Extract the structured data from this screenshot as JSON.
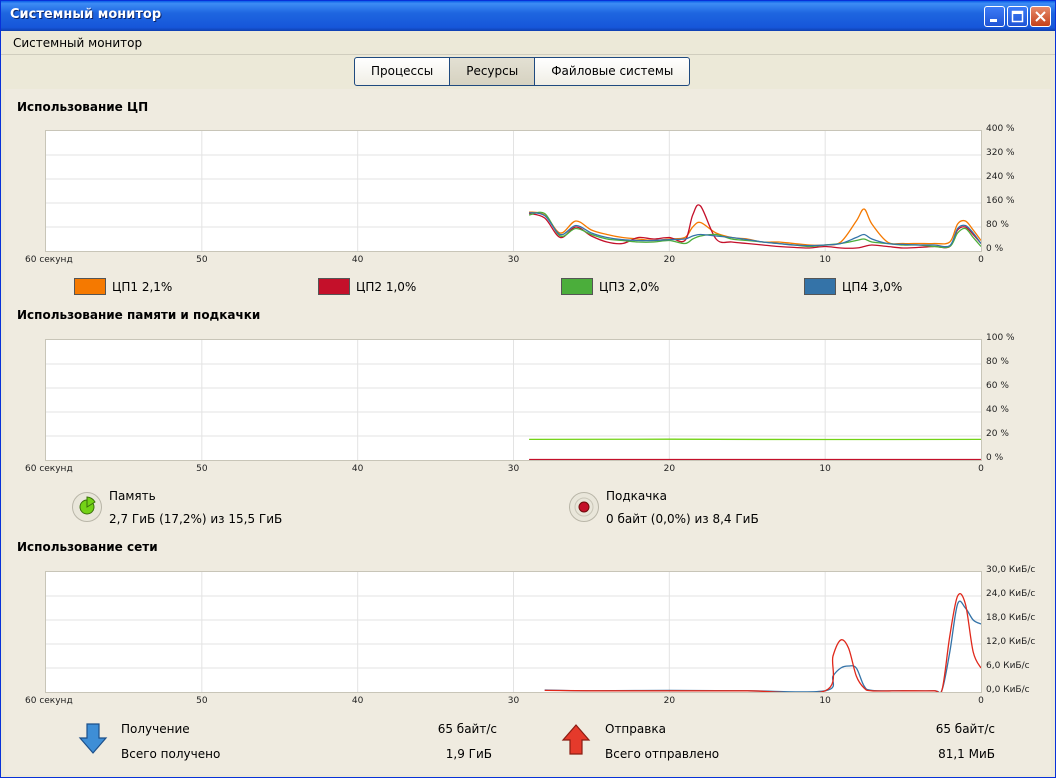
{
  "window": {
    "title": "Системный монитор"
  },
  "menu": {
    "app_menu": "Системный монитор"
  },
  "tabs": [
    {
      "label": "Процессы",
      "active": false
    },
    {
      "label": "Ресурсы",
      "active": true
    },
    {
      "label": "Файловые системы",
      "active": false
    }
  ],
  "time_axis": [
    "60 секунд",
    "50",
    "40",
    "30",
    "20",
    "10",
    "0"
  ],
  "cpu": {
    "title": "Использование ЦП",
    "y_ticks": [
      "400 %",
      "320 %",
      "240 %",
      "160 %",
      "80 %",
      "0 %"
    ],
    "legend": [
      {
        "name": "ЦП1",
        "value": "2,1%",
        "color": "#F57900"
      },
      {
        "name": "ЦП2",
        "value": "1,0%",
        "color": "#C4102A"
      },
      {
        "name": "ЦП3",
        "value": "2,0%",
        "color": "#4BAE3B"
      },
      {
        "name": "ЦП4",
        "value": "3,0%",
        "color": "#3473A8"
      }
    ]
  },
  "memory": {
    "title": "Использование памяти и подкачки",
    "y_ticks": [
      "100 %",
      "80 %",
      "60 %",
      "40 %",
      "20 %",
      "0 %"
    ],
    "mem_label": "Память",
    "mem_value": "2,7 ГиБ (17,2%) из 15,5 ГиБ",
    "mem_color": "#73D216",
    "swap_label": "Подкачка",
    "swap_value": "0 байт (0,0%) из 8,4 ГиБ",
    "swap_color": "#C4102A"
  },
  "network": {
    "title": "Использование сети",
    "y_ticks": [
      "30,0 КиБ/с",
      "24,0 КиБ/с",
      "18,0 КиБ/с",
      "12,0 КиБ/с",
      "6,0 КиБ/с",
      "0,0 КиБ/с"
    ],
    "recv_label": "Получение",
    "recv_rate": "65 байт/с",
    "recv_total_label": "Всего получено",
    "recv_total": "1,9 ГиБ",
    "recv_color": "#3473A8",
    "send_label": "Отправка",
    "send_rate": "65 байт/с",
    "send_total_label": "Всего отправлено",
    "send_total": "81,1 МиБ",
    "send_color": "#E0281B"
  },
  "chart_data": [
    {
      "type": "line",
      "title": "Использование ЦП",
      "x": [
        29,
        28,
        27,
        26,
        25,
        24,
        23,
        22,
        21,
        20,
        19,
        18.5,
        18,
        17,
        16,
        15,
        14,
        13,
        12,
        11,
        10,
        9,
        8,
        7.5,
        7,
        6,
        5,
        4,
        3,
        2,
        1.5,
        1,
        0.5,
        0
      ],
      "xlim": [
        60,
        0
      ],
      "ylim": [
        0,
        400
      ],
      "series": [
        {
          "name": "ЦП1",
          "values": [
            130,
            120,
            60,
            100,
            70,
            55,
            45,
            40,
            35,
            40,
            45,
            80,
            95,
            60,
            45,
            40,
            30,
            30,
            25,
            20,
            20,
            30,
            100,
            140,
            90,
            30,
            25,
            25,
            25,
            30,
            90,
            100,
            70,
            35
          ]
        },
        {
          "name": "ЦП2",
          "values": [
            125,
            110,
            45,
            80,
            50,
            30,
            25,
            45,
            40,
            45,
            35,
            120,
            150,
            40,
            30,
            25,
            20,
            15,
            12,
            10,
            15,
            10,
            10,
            15,
            20,
            15,
            10,
            12,
            15,
            15,
            70,
            80,
            55,
            25
          ]
        },
        {
          "name": "ЦП3",
          "values": [
            120,
            125,
            50,
            75,
            55,
            40,
            35,
            30,
            30,
            35,
            25,
            40,
            50,
            55,
            40,
            35,
            30,
            25,
            20,
            15,
            20,
            25,
            35,
            40,
            30,
            25,
            20,
            20,
            15,
            15,
            60,
            75,
            45,
            15
          ]
        },
        {
          "name": "ЦП4",
          "values": [
            128,
            118,
            55,
            85,
            60,
            45,
            38,
            35,
            35,
            38,
            40,
            50,
            55,
            50,
            45,
            38,
            30,
            25,
            20,
            18,
            20,
            25,
            45,
            55,
            40,
            25,
            22,
            20,
            20,
            18,
            75,
            85,
            60,
            25
          ]
        }
      ]
    },
    {
      "type": "line",
      "title": "Использование памяти и подкачки",
      "x": [
        29,
        20,
        10,
        0
      ],
      "xlim": [
        60,
        0
      ],
      "ylim": [
        0,
        100
      ],
      "series": [
        {
          "name": "Память",
          "values": [
            17.2,
            17.3,
            17.1,
            17.2
          ]
        },
        {
          "name": "Подкачка",
          "values": [
            0,
            0,
            0,
            0
          ]
        }
      ]
    },
    {
      "type": "line",
      "title": "Использование сети",
      "x": [
        28,
        25,
        20,
        15,
        10,
        9.5,
        9,
        8.5,
        8,
        7.5,
        7,
        5,
        3,
        2.5,
        2,
        1.5,
        1,
        0.5,
        0
      ],
      "xlim": [
        60,
        0
      ],
      "ylim": [
        0,
        30
      ],
      "series": [
        {
          "name": "Получение",
          "values": [
            0.5,
            0.3,
            0.4,
            0.3,
            0.3,
            4,
            6,
            6.5,
            6,
            1.5,
            0.4,
            0.3,
            0.3,
            0.5,
            10,
            22,
            21,
            18,
            17
          ]
        },
        {
          "name": "Отправка",
          "values": [
            0.4,
            0.3,
            0.3,
            0.3,
            0.3,
            9,
            13,
            11,
            4,
            1,
            0.3,
            0.3,
            0.3,
            0.5,
            14,
            24,
            22,
            10,
            6
          ]
        }
      ]
    }
  ]
}
